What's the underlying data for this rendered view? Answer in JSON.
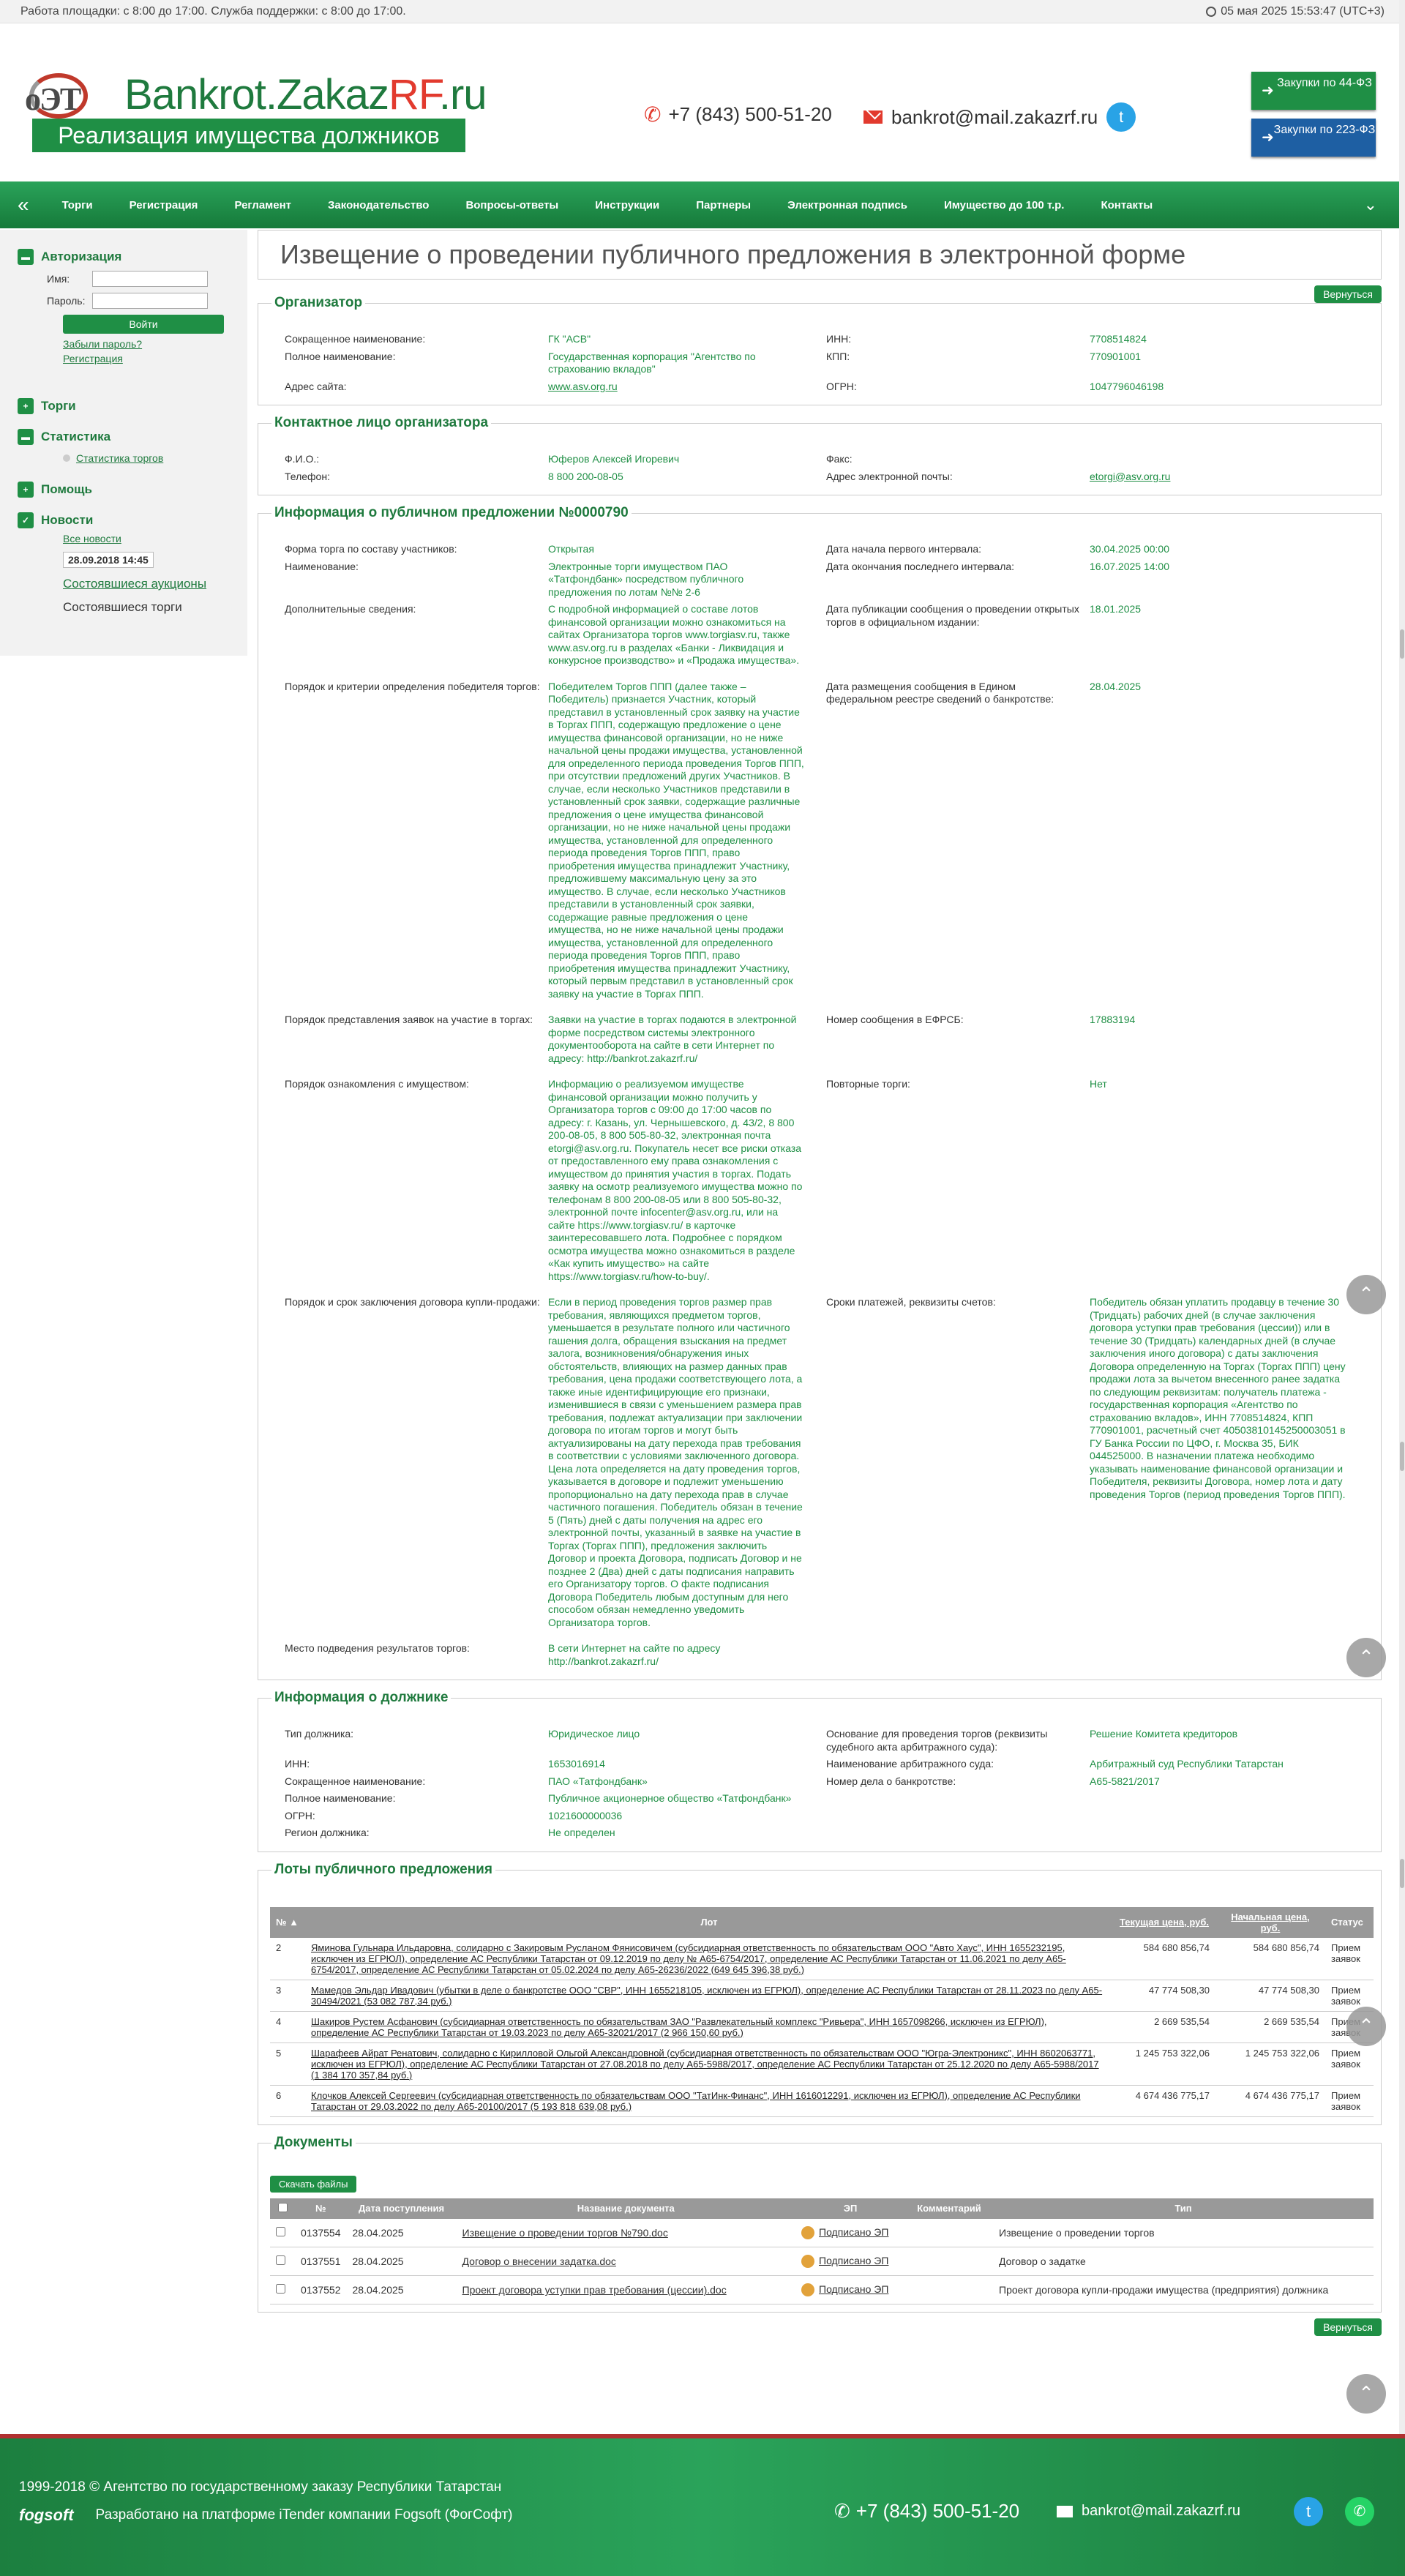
{
  "topbar": {
    "hours": "Работа площадки: с 8:00 до 17:00. Служба поддержки: с 8:00 до 17:00.",
    "datetime": "05 мая 2025 15:53:47 (UTC+3)"
  },
  "header": {
    "logo_text": "оЭТ",
    "brand_main": "Bankrot.Zakaz",
    "brand_rf": "RF",
    "brand_ru": ".ru",
    "brand_sub": "Реализация имущества должников",
    "phone": "+7 (843) 500-51-20",
    "email": "bankrot@mail.zakazrf.ru",
    "btn44": "Закупки по 44-ФЗ",
    "btn223": "Закупки по 223-ФЗ"
  },
  "nav": [
    "Торги",
    "Регистрация",
    "Регламент",
    "Законодательство",
    "Вопросы-ответы",
    "Инструкции",
    "Партнеры",
    "Электронная подпись",
    "Имущество до 100 т.р.",
    "Контакты"
  ],
  "sidebar": {
    "auth": "Авторизация",
    "name_label": "Имя:",
    "pass_label": "Пароль:",
    "login": "Войти",
    "forgot": "Забыли пароль?",
    "register": "Регистрация",
    "trades": "Торги",
    "stats": "Статистика",
    "stats_sub": "Статистика торгов",
    "help": "Помощь",
    "news": "Новости",
    "all_news": "Все новости",
    "date": "28.09.2018 14:45",
    "news1": "Состоявшиеся аукционы",
    "news2": "Состоявшиеся торги"
  },
  "page": {
    "title": "Извещение о проведении публичного предложения в электронной форме",
    "back": "Вернуться"
  },
  "organizer": {
    "title": "Организатор",
    "short_label": "Сокращенное наименование:",
    "short": "ГК \"АСВ\"",
    "inn_label": "ИНН:",
    "inn": "7708514824",
    "full_label": "Полное наименование:",
    "full": "Государственная корпорация \"Агентство по страхованию вкладов\"",
    "kpp_label": "КПП:",
    "kpp": "770901001",
    "site_label": "Адрес сайта:",
    "site": "www.asv.org.ru",
    "ogrn_label": "ОГРН:",
    "ogrn": "1047796046198"
  },
  "contact": {
    "title": "Контактное лицо организатора",
    "fio_label": "Ф.И.О.:",
    "fio": "Юферов Алексей Игоревич",
    "fax_label": "Факс:",
    "fax": "",
    "phone_label": "Телефон:",
    "phone": "8 800 200-08-05",
    "email_label": "Адрес электронной почты:",
    "email": "etorgi@asv.org.ru"
  },
  "info": {
    "title": "Информация о публичном предложении №0000790",
    "form_label": "Форма торга по составу участников:",
    "form": "Открытая",
    "start_label": "Дата начала первого интервала:",
    "start": "30.04.2025 00:00",
    "name_label": "Наименование:",
    "name": "Электронные торги имуществом ПАО «Татфондбанк» посредством публичного предложения по лотам №№ 2-6",
    "end_label": "Дата окончания последнего интервала:",
    "end": "16.07.2025 14:00",
    "extra_label": "Дополнительные сведения:",
    "extra": "С подробной информацией о составе лотов финансовой организации можно ознакомиться на сайтах Организатора торгов www.torgiasv.ru, также www.asv.org.ru в разделах «Банки - Ликвидация и конкурсное производство» и «Продажа имущества».",
    "pub_label": "Дата публикации сообщения о проведении открытых торгов в официальном издании:",
    "pub": "18.01.2025",
    "order_label": "Порядок и критерии определения победителя торгов:",
    "order": "Победителем Торгов ППП (далее также – Победитель) признается Участник, который представил в установленный срок заявку на участие в Торгах ППП, содержащую предложение о цене имущества финансовой организации, но не ниже начальной цены продажи имущества, установленной для определенного периода проведения Торгов ППП, при отсутствии предложений других Участников. В случае, если несколько Участников представили в установленный срок заявки, содержащие различные предложения о цене имущества финансовой организации, но не ниже начальной цены продажи имущества, установленной для определенного периода проведения Торгов ППП, право приобретения имущества принадлежит Участнику, предложившему максимальную цену за это имущество. В случае, если несколько Участников представили в установленный срок заявки, содержащие равные предложения о цене имущества, но не ниже начальной цены продажи имущества, установленной для определенного периода проведения Торгов ППП, право приобретения имущества принадлежит Участнику, который первым представил в установленный срок заявку на участие в Торгах ППП.",
    "efrsb_date_label": "Дата размещения сообщения в Едином федеральном реестре сведений о банкротстве:",
    "efrsb_date": "28.04.2025",
    "apply_label": "Порядок представления заявок на участие в торгах:",
    "apply": "Заявки на участие в торгах подаются в электронной форме посредством системы электронного документооборота на сайте в сети Интернет по адресу: http://bankrot.zakazrf.ru/",
    "efrsb_num_label": "Номер сообщения в ЕФРСБ:",
    "efrsb_num": "17883194",
    "review_label": "Порядок ознакомления с имуществом:",
    "review": "Информацию о реализуемом имуществе финансовой организации можно получить у Организатора торгов с 09:00 до 17:00 часов по адресу: г. Казань, ул. Чернышевского, д. 43/2, 8 800 200-08-05, 8 800 505-80-32, электронная почта etorgi@asv.org.ru. Покупатель несет все риски отказа от предоставленного ему права ознакомления с имуществом до принятия участия в торгах. Подать заявку на осмотр реализуемого имущества можно по телефонам 8 800 200-08-05 или 8 800 505-80-32, электронной почте infocenter@asv.org.ru, или на сайте https://www.torgiasv.ru/ в карточке заинтересовавшего лота. Подробнее с порядком осмотра имущества можно ознакомиться в разделе «Как купить имущество» на сайте https://www.torgiasv.ru/how-to-buy/.",
    "repeat_label": "Повторные торги:",
    "repeat": "Нет",
    "contract_label": "Порядок и срок заключения договора купли-продажи:",
    "contract": "Если в период проведения торгов размер прав требования, являющихся предметом торгов, уменьшается в результате полного или частичного гашения долга, обращения взыскания на предмет залога, возникновения/обнаружения иных обстоятельств, влияющих на размер данных прав требования, цена продажи соответствующего лота, а также иные идентифицирующие его признаки, изменившиеся в связи с уменьшением размера прав требования, подлежат актуализации при заключении договора по итогам торгов и могут быть актуализированы на дату перехода прав требования в соответствии с условиями заключенного договора. Цена лота определяется на дату проведения торгов, указывается в договоре и подлежит уменьшению пропорционально на дату перехода прав в случае частичного погашения. Победитель обязан в течение 5 (Пять) дней с даты получения на адрес его электронной почты, указанный в заявке на участие в Торгах (Торгах ППП), предложения заключить Договор и проекта Договора, подписать Договор и не позднее 2 (Два) дней с даты подписания направить его Организатору торгов. О факте подписания Договора Победитель любым доступным для него способом обязан немедленно уведомить Организатора торгов.",
    "pay_label": "Сроки платежей, реквизиты счетов:",
    "pay": "Победитель обязан уплатить продавцу в течение 30 (Тридцать) рабочих дней (в случае заключения договора уступки прав требования (цессии)) или в течение 30 (Тридцать) календарных дней (в случае заключения иного договора) с даты заключения Договора определенную на Торгах (Торгах ППП) цену продажи лота за вычетом внесенного ранее задатка по следующим реквизитам: получатель платежа - государственная корпорация «Агентство по страхованию вкладов», ИНН 7708514824, КПП 770901001, расчетный счет 40503810145250003051 в ГУ Банка России по ЦФО, г. Москва 35, БИК 044525000. В назначении платежа необходимо указывать наименование финансовой организации и Победителя, реквизиты Договора, номер лота и дату проведения Торгов (период проведения Торгов ППП).",
    "place_label": "Место подведения результатов торгов:",
    "place": "В сети Интернет на сайте по адресу http://bankrot.zakazrf.ru/"
  },
  "debtor": {
    "title": "Информация о должнике",
    "type_label": "Тип должника:",
    "type": "Юридическое лицо",
    "basis_label": "Основание для проведения торгов (реквизиты судебного акта арбитражного суда):",
    "basis": "Решение Комитета кредиторов",
    "inn_label": "ИНН:",
    "inn": "1653016914",
    "court_label": "Наименование арбитражного суда:",
    "court": "Арбитражный суд Республики Татарстан",
    "short_label": "Сокращенное наименование:",
    "short": "ПАО «Татфондбанк»",
    "case_label": "Номер дела о банкротстве:",
    "case": "А65-5821/2017",
    "full_label": "Полное наименование:",
    "full": "Публичное акционерное общество «Татфондбанк»",
    "ogrn_label": "ОГРН:",
    "ogrn": "1021600000036",
    "region_label": "Регион должника:",
    "region": "Не определен"
  },
  "lots": {
    "title": "Лоты публичного предложения",
    "headers": [
      "№ ▲",
      "Лот",
      "Текущая цена, руб.",
      "Начальная цена, руб.",
      "Статус"
    ],
    "rows": [
      {
        "n": "2",
        "lot": "Яминова Гульнара Ильдаровна, солидарно с Закировым Русланом Фянисовичем (субсидиарная ответственность по обязательствам ООО \"Авто Хаус\", ИНН 1655232195, исключен из ЕГРЮЛ), определение АС Республики Татарстан от 09.12.2019 по делу № А65-6754/2017, определение АС Республики Татарстан от 11.06.2021 по делу А65-6754/2017, определение АС Республики Татарстан от 05.02.2024 по делу А65-26236/2022 (649 645 396,38 руб.)",
        "cur": "584 680 856,74",
        "start": "584 680 856,74",
        "status": "Прием заявок"
      },
      {
        "n": "3",
        "lot": "Мамедов Эльдар Ивадович (убытки в деле о банкротстве ООО \"СВР\", ИНН 1655218105, исключен из ЕГРЮЛ), определение АС Республики Татарстан от 28.11.2023 по делу А65-30494/2021 (53 082 787,34 руб.)",
        "cur": "47 774 508,30",
        "start": "47 774 508,30",
        "status": "Прием заявок"
      },
      {
        "n": "4",
        "lot": "Шакиров Рустем Асфанович (субсидиарная ответственность по обязательствам ЗАО \"Развлекательный комплекс \"Ривьера\", ИНН 1657098266, исключен из ЕГРЮЛ), определение АС Республики Татарстан от 19.03.2023 по делу А65-32021/2017 (2 966 150,60 руб.)",
        "cur": "2 669 535,54",
        "start": "2 669 535,54",
        "status": "Прием заявок"
      },
      {
        "n": "5",
        "lot": "Шарафеев Айрат Ренатович, солидарно с Кирилловой Ольгой Александровной (субсидиарная ответственность по обязательствам ООО \"Югра-Электроникс\", ИНН 8602063771, исключен из ЕГРЮЛ), определение АС Республики Татарстан от 27.08.2018 по делу А65-5988/2017, определение АС Республики Татарстан от 25.12.2020 по делу А65-5988/2017 (1 384 170 357,84 руб.)",
        "cur": "1 245 753 322,06",
        "start": "1 245 753 322,06",
        "status": "Прием заявок"
      },
      {
        "n": "6",
        "lot": "Клочков Алексей Сергеевич (субсидиарная ответственность по обязательствам ООО \"ТатИнк-Финанс\", ИНН 1616012291, исключен из ЕГРЮЛ), определение АС Республики Татарстан от 29.03.2022 по делу А65-20100/2017 (5 193 818 639,08 руб.)",
        "cur": "4 674 436 775,17",
        "start": "4 674 436 775,17",
        "status": "Прием заявок"
      }
    ]
  },
  "docs": {
    "title": "Документы",
    "download": "Скачать файлы",
    "headers": [
      "№",
      "Дата поступления",
      "Название документа",
      "ЭП",
      "Комментарий",
      "Тип"
    ],
    "rows": [
      {
        "n": "0137554",
        "date": "28.04.2025",
        "name": "Извещение о проведении торгов №790.doc",
        "ep": "Подписано ЭП",
        "comment": "",
        "type": "Извещение о проведении торгов"
      },
      {
        "n": "0137551",
        "date": "28.04.2025",
        "name": "Договор о внесении задатка.doc",
        "ep": "Подписано ЭП",
        "comment": "",
        "type": "Договор о задатке"
      },
      {
        "n": "0137552",
        "date": "28.04.2025",
        "name": "Проект договора уступки прав требования (цессии).doc",
        "ep": "Подписано ЭП",
        "comment": "",
        "type": "Проект договора купли-продажи имущества (предприятия) должника"
      }
    ],
    "back": "Вернуться"
  },
  "footer": {
    "copy": "1999-2018 © Агентство по государственному заказу Республики Татарстан",
    "fogsoft": "fogsoft",
    "platform": "Разработано на платформе iTender компании Fogsoft (ФогСофт)",
    "phone": "+7 (843) 500-51-20",
    "email": "bankrot@mail.zakazrf.ru"
  }
}
